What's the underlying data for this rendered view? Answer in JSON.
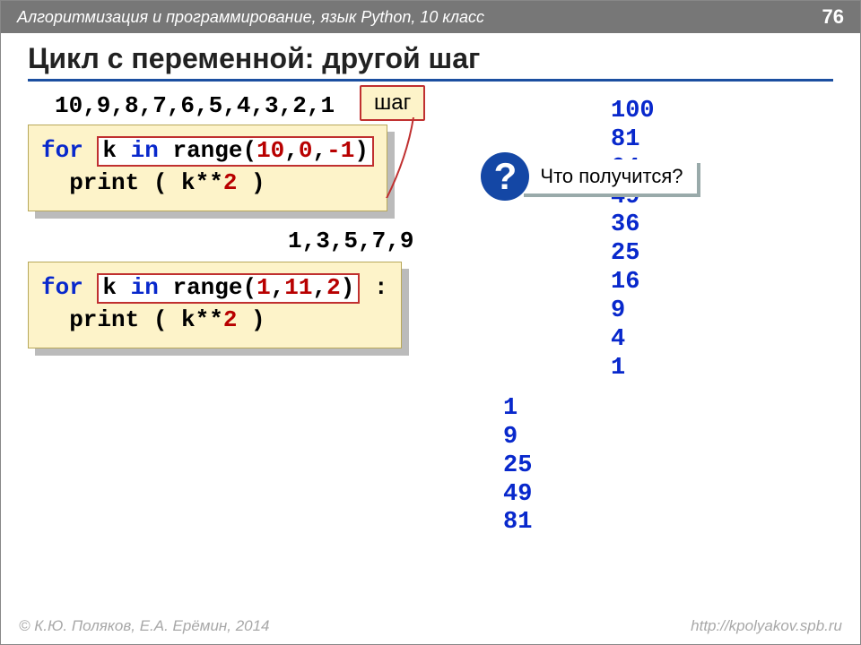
{
  "header": {
    "breadcrumb": "Алгоритмизация и программирование, язык Python, 10 класс",
    "page_number": "76"
  },
  "title": "Цикл с переменной: другой шаг",
  "callout_label": "шаг",
  "seq1": "10,9,8,7,6,5,4,3,2,1",
  "code1": {
    "for": "for ",
    "highlight": "k in range(10,0,-1)",
    "hl_pre": "k ",
    "hl_in": "in",
    "hl_mid": " range(",
    "hl_n1": "10",
    "hl_c1": ",",
    "hl_n2": "0",
    "hl_c2": ",",
    "hl_n3": "-1",
    "hl_post": ")",
    "line2_indent": "  print ( k**",
    "line2_pow": "2",
    "line2_end": " )"
  },
  "question": "Что получится?",
  "seq2": "1,3,5,7,9",
  "code2": {
    "for": "for ",
    "hl_pre": "k ",
    "hl_in": "in",
    "hl_mid": " range(",
    "hl_n1": "1",
    "hl_c1": ",",
    "hl_n2": "11",
    "hl_c2": ",",
    "hl_n3": "2",
    "hl_post": ")",
    "after_box": " :",
    "line2_indent": "  print ( k**",
    "line2_pow": "2",
    "line2_end": " )"
  },
  "output1": [
    "100",
    "81",
    "64",
    "49",
    "36",
    "25",
    "16",
    "9",
    "4",
    "1"
  ],
  "output2": [
    "1",
    "9",
    "25",
    "49",
    "81"
  ],
  "footer": {
    "copyright": "© К.Ю. Поляков, Е.А. Ерёмин, 2014",
    "link": "http://kpolyakov.spb.ru"
  }
}
